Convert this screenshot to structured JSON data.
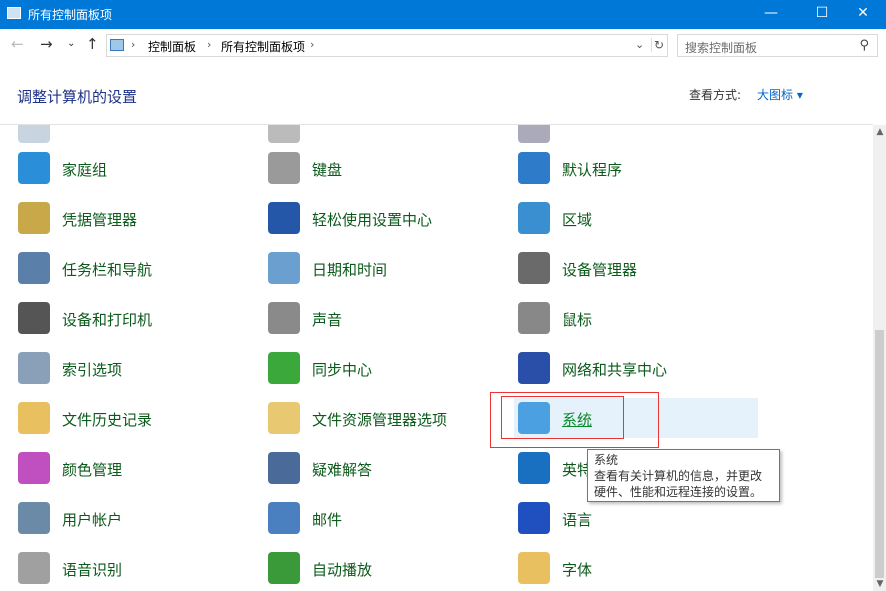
{
  "window": {
    "title": "所有控制面板项",
    "minimize": "—",
    "maximize": "☐",
    "close": "✕"
  },
  "nav": {
    "back": "←",
    "forward": "→",
    "recent": "⌄",
    "up": "↑",
    "refresh": "↻",
    "dropdown": "⌄"
  },
  "breadcrumb": [
    "控制面板",
    "所有控制面板项"
  ],
  "search": {
    "placeholder": "搜索控制面板",
    "icon": "search-icon"
  },
  "heading": "调整计算机的设置",
  "view": {
    "label": "查看方式:",
    "value": "大图标 ▾"
  },
  "items": [
    {
      "label": "家庭组",
      "icon": "homegroup-icon",
      "color": "#2a8fd8"
    },
    {
      "label": "键盘",
      "icon": "keyboard-icon",
      "color": "#9a9a9a"
    },
    {
      "label": "默认程序",
      "icon": "default-programs-icon",
      "color": "#2e7bc9"
    },
    {
      "label": "凭据管理器",
      "icon": "credential-manager-icon",
      "color": "#c9a84a"
    },
    {
      "label": "轻松使用设置中心",
      "icon": "ease-of-access-icon",
      "color": "#2457a8"
    },
    {
      "label": "区域",
      "icon": "region-icon",
      "color": "#3a8fd0"
    },
    {
      "label": "任务栏和导航",
      "icon": "taskbar-icon",
      "color": "#5a7fa8"
    },
    {
      "label": "日期和时间",
      "icon": "date-time-icon",
      "color": "#6a9fd0"
    },
    {
      "label": "设备管理器",
      "icon": "device-manager-icon",
      "color": "#6a6a6a"
    },
    {
      "label": "设备和打印机",
      "icon": "devices-printers-icon",
      "color": "#555555"
    },
    {
      "label": "声音",
      "icon": "sound-icon",
      "color": "#8a8a8a"
    },
    {
      "label": "鼠标",
      "icon": "mouse-icon",
      "color": "#888888"
    },
    {
      "label": "索引选项",
      "icon": "indexing-icon",
      "color": "#8aa0b8"
    },
    {
      "label": "同步中心",
      "icon": "sync-center-icon",
      "color": "#3aa83a"
    },
    {
      "label": "网络和共享中心",
      "icon": "network-icon",
      "color": "#2a4fa8"
    },
    {
      "label": "文件历史记录",
      "icon": "file-history-icon",
      "color": "#e8c060"
    },
    {
      "label": "文件资源管理器选项",
      "icon": "folder-options-icon",
      "color": "#e8c870"
    },
    {
      "label": "系统",
      "icon": "system-icon",
      "color": "#4aa0e0"
    },
    {
      "label": "颜色管理",
      "icon": "color-management-icon",
      "color": "#c050c0"
    },
    {
      "label": "疑难解答",
      "icon": "troubleshooting-icon",
      "color": "#4a6a9a"
    },
    {
      "label": "英特尔® 核芯显卡",
      "icon": "intel-graphics-icon",
      "color": "#1a70c0"
    },
    {
      "label": "用户帐户",
      "icon": "user-accounts-icon",
      "color": "#6a8aa8"
    },
    {
      "label": "邮件",
      "icon": "mail-icon",
      "color": "#4a80c0"
    },
    {
      "label": "语言",
      "icon": "language-icon",
      "color": "#2050c0"
    },
    {
      "label": "语音识别",
      "icon": "speech-recognition-icon",
      "color": "#a0a0a0"
    },
    {
      "label": "自动播放",
      "icon": "autoplay-icon",
      "color": "#3a9a3a"
    },
    {
      "label": "字体",
      "icon": "fonts-icon",
      "color": "#e8c060"
    }
  ],
  "tooltip": {
    "title": "系统",
    "text": "查看有关计算机的信息，并更改硬件、性能和远程连接的设置。"
  }
}
